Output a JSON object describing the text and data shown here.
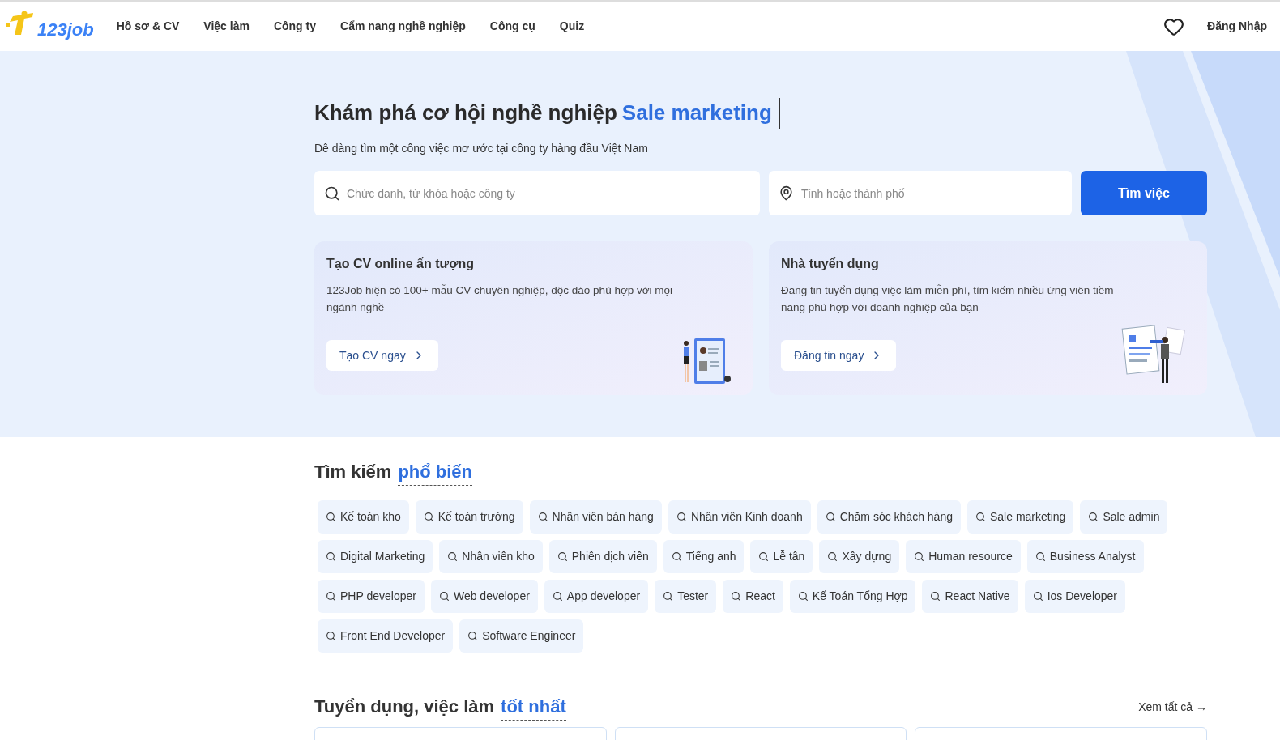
{
  "header": {
    "logo": "123job",
    "nav": [
      "Hồ sơ & CV",
      "Việc làm",
      "Công ty",
      "Cẩm nang nghề nghiệp",
      "Công cụ",
      "Quiz"
    ],
    "login": "Đăng Nhập"
  },
  "hero": {
    "title": "Khám phá cơ hội nghề nghiệp",
    "title_highlight": "Sale marketing",
    "subtitle": "Dễ dàng tìm một công việc mơ ước tại công ty hàng đầu Việt Nam",
    "keyword_field": {
      "placeholder": "Chức danh, từ khóa hoặc công ty"
    },
    "location_field": {
      "placeholder": "Tỉnh hoặc thành phố"
    },
    "search_button": "Tìm việc",
    "cards": [
      {
        "kind": "cv",
        "title": "Tạo CV online ấn tượng",
        "text": "123Job hiện có 100+ mẫu CV chuyên nghiệp, độc đáo phù hợp với mọi ngành nghề",
        "button": "Tạo CV ngay"
      },
      {
        "kind": "employer",
        "title": "Nhà tuyển dụng",
        "text": "Đăng tin tuyển dụng việc làm miễn phí, tìm kiếm nhiều ứng viên tiềm năng phù hợp với doanh nghiệp của bạn",
        "button": "Đăng tin ngay"
      }
    ]
  },
  "popular": {
    "title": "Tìm kiếm",
    "title_highlight": "phổ biến",
    "tags": [
      "Kế toán kho",
      "Kế toán trưởng",
      "Nhân viên bán hàng",
      "Nhân viên Kinh doanh",
      "Chăm sóc khách hàng",
      "Sale marketing",
      "Sale admin",
      "Digital Marketing",
      "Nhân viên kho",
      "Phiên dịch viên",
      "Tiếng anh",
      "Lễ tân",
      "Xây dựng",
      "Human resource",
      "Business Analyst",
      "PHP developer",
      "Web developer",
      "App developer",
      "Tester",
      "React",
      "Kế Toán Tổng Hợp",
      "React Native",
      "Ios Developer",
      "Front End Developer",
      "Software Engineer"
    ]
  },
  "best_jobs": {
    "title": "Tuyển dụng, việc làm",
    "title_highlight": "tốt nhất",
    "see_all": "Xem tất cả →"
  }
}
